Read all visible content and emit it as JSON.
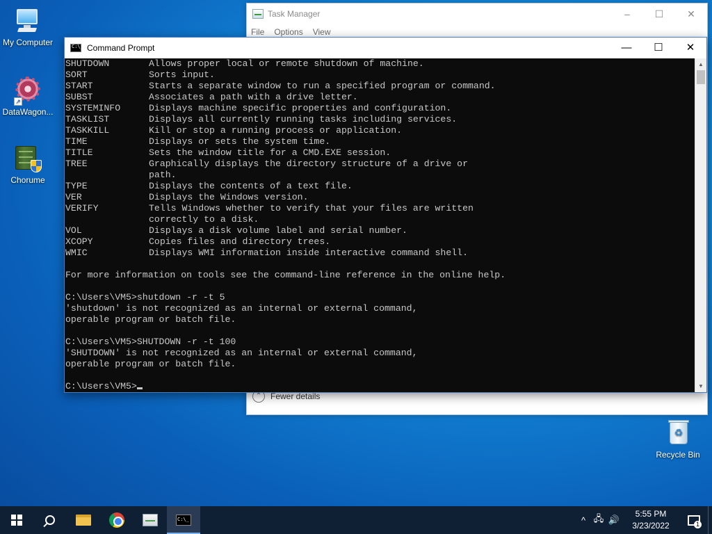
{
  "desktop": {
    "icons": [
      {
        "label": "My Computer",
        "icon": "computer-icon"
      },
      {
        "label": "DataWagon...",
        "icon": "datawagon-icon"
      },
      {
        "label": "Chorume",
        "icon": "chorume-icon"
      },
      {
        "label": "Recycle Bin",
        "icon": "recycle-bin-icon"
      }
    ]
  },
  "task_manager": {
    "title": "Task Manager",
    "menu": [
      "File",
      "Options",
      "View"
    ],
    "fewer_details": "Fewer details",
    "buttons": {
      "minimize": "–",
      "maximize": "☐",
      "close": "✕"
    }
  },
  "cmd": {
    "title": "Command Prompt",
    "buttons": {
      "minimize": "—",
      "maximize": "☐",
      "close": "✕"
    },
    "commands": [
      {
        "name": "SHUTDOWN",
        "desc": "Allows proper local or remote shutdown of machine."
      },
      {
        "name": "SORT",
        "desc": "Sorts input."
      },
      {
        "name": "START",
        "desc": "Starts a separate window to run a specified program or command."
      },
      {
        "name": "SUBST",
        "desc": "Associates a path with a drive letter."
      },
      {
        "name": "SYSTEMINFO",
        "desc": "Displays machine specific properties and configuration."
      },
      {
        "name": "TASKLIST",
        "desc": "Displays all currently running tasks including services."
      },
      {
        "name": "TASKKILL",
        "desc": "Kill or stop a running process or application."
      },
      {
        "name": "TIME",
        "desc": "Displays or sets the system time."
      },
      {
        "name": "TITLE",
        "desc": "Sets the window title for a CMD.EXE session."
      },
      {
        "name": "TREE",
        "desc": "Graphically displays the directory structure of a drive or"
      },
      {
        "name": "",
        "desc": "path."
      },
      {
        "name": "TYPE",
        "desc": "Displays the contents of a text file."
      },
      {
        "name": "VER",
        "desc": "Displays the Windows version."
      },
      {
        "name": "VERIFY",
        "desc": "Tells Windows whether to verify that your files are written"
      },
      {
        "name": "",
        "desc": "correctly to a disk."
      },
      {
        "name": "VOL",
        "desc": "Displays a disk volume label and serial number."
      },
      {
        "name": "XCOPY",
        "desc": "Copies files and directory trees."
      },
      {
        "name": "WMIC",
        "desc": "Displays WMI information inside interactive command shell."
      }
    ],
    "more_info": "For more information on tools see the command-line reference in the online help.",
    "session": [
      "C:\\Users\\VM5>shutdown -r -t 5",
      "'shutdown' is not recognized as an internal or external command,",
      "operable program or batch file.",
      "",
      "C:\\Users\\VM5>SHUTDOWN -r -t 100",
      "'SHUTDOWN' is not recognized as an internal or external command,",
      "operable program or batch file.",
      ""
    ],
    "prompt": "C:\\Users\\VM5>"
  },
  "taskbar": {
    "apps": [
      {
        "name": "start",
        "icon": "windows-logo-icon",
        "active": false
      },
      {
        "name": "search",
        "icon": "search-icon",
        "active": false
      },
      {
        "name": "file-explorer",
        "icon": "folder-icon",
        "active": false
      },
      {
        "name": "chrome",
        "icon": "chrome-icon",
        "active": false
      },
      {
        "name": "task-manager",
        "icon": "task-manager-icon",
        "active": false
      },
      {
        "name": "command-prompt",
        "icon": "cmd-icon",
        "active": true
      }
    ],
    "tray": {
      "chevron": "^",
      "network": "🖧",
      "volume": "🔊",
      "time": "5:55 PM",
      "date": "3/23/2022",
      "notification_count": "1"
    }
  }
}
